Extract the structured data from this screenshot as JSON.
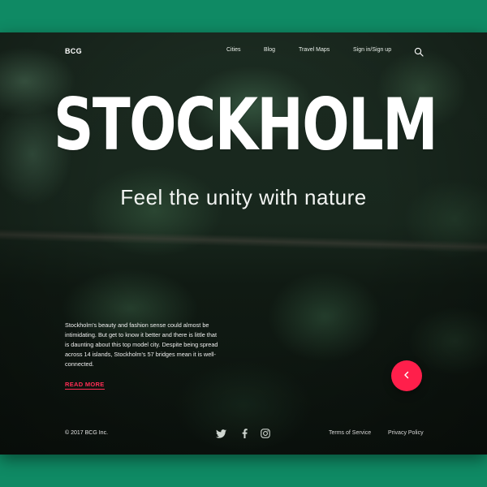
{
  "nav": {
    "logo": "BCG",
    "links": [
      "Cities",
      "Blog",
      "Travel Maps",
      "Sign in/Sign up"
    ]
  },
  "hero": {
    "title": "STOCKHOLM",
    "subtitle": "Feel the unity with nature"
  },
  "content": {
    "description": "Stockholm's beauty and fashion sense could almost be intimidating. But get to know it better and there is little that is daunting about this top model city. Despite being spread across 14 islands, Stockholm's 57 bridges mean it is well-connected.",
    "read_more": "READ MORE"
  },
  "footer": {
    "copyright": "© 2017 BCG Inc.",
    "terms": "Terms of Service",
    "privacy": "Privacy Policy",
    "social_icons": [
      "twitter-icon",
      "facebook-icon",
      "instagram-icon"
    ]
  },
  "colors": {
    "accent": "#ff1f4b",
    "page_background": "#0f8a64"
  }
}
